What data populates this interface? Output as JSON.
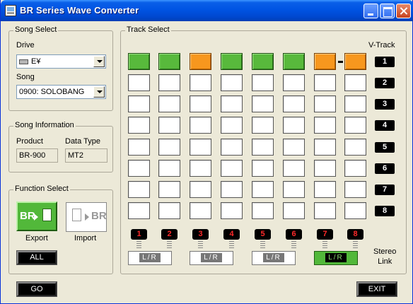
{
  "window": {
    "title": "BR Series Wave Converter"
  },
  "song_select": {
    "title": "Song Select",
    "drive_label": "Drive",
    "drive_value": "E¥",
    "song_label": "Song",
    "song_value": "0900: SOLOBANG"
  },
  "song_info": {
    "title": "Song Information",
    "product_label": "Product",
    "product_value": "BR-900",
    "datatype_label": "Data Type",
    "datatype_value": "MT2"
  },
  "function_select": {
    "title": "Function Select",
    "export_label": "Export",
    "import_label": "Import",
    "export_icon_text": "BR",
    "import_icon_text": "BR",
    "all_label": "ALL"
  },
  "track_select": {
    "title": "Track Select",
    "vtrack_title": "V-Track",
    "vtracks": [
      "1",
      "2",
      "3",
      "4",
      "5",
      "6",
      "7",
      "8"
    ],
    "tracks": [
      "1",
      "2",
      "3",
      "4",
      "5",
      "6",
      "7",
      "8"
    ],
    "row1_states": [
      "green",
      "green",
      "orange",
      "green",
      "green",
      "green",
      "orange",
      "orange"
    ],
    "lr_label": "L/R",
    "lr_states": [
      "off",
      "off",
      "off",
      "on"
    ],
    "stereo_link_label_1": "Stereo",
    "stereo_link_label_2": "Link"
  },
  "footer": {
    "go_label": "GO",
    "exit_label": "EXIT"
  },
  "colors": {
    "selected_green": "#58b93c",
    "selected_orange": "#f7971e",
    "title_blue": "#0054e3"
  },
  "icons": [
    "app-icon",
    "minimize-icon",
    "maximize-icon",
    "close-icon",
    "drive-icon",
    "dropdown-arrow-icon",
    "export-icon",
    "import-icon"
  ]
}
